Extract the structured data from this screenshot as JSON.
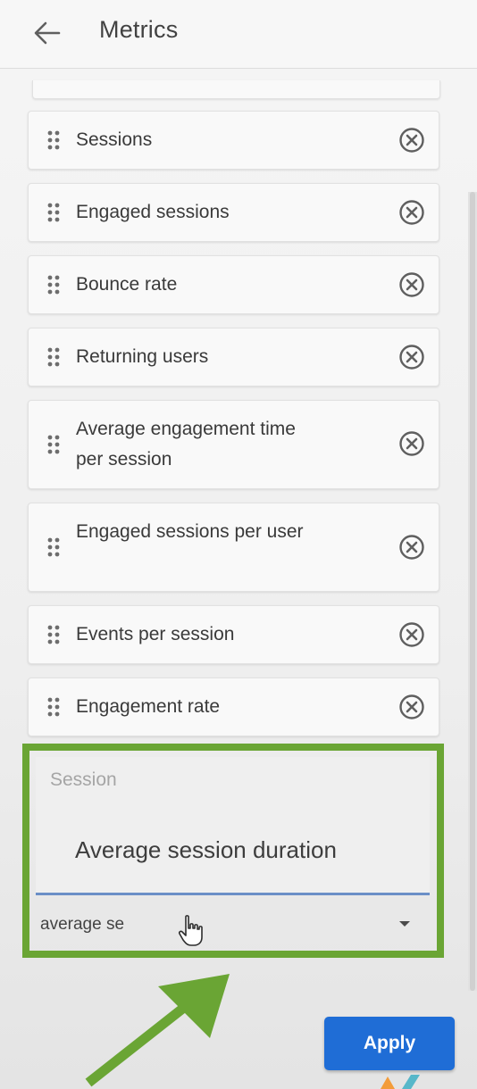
{
  "header": {
    "title": "Metrics",
    "back_icon": "arrow-back-icon"
  },
  "metrics": [
    {
      "label": "Sessions"
    },
    {
      "label": "Engaged sessions"
    },
    {
      "label": "Bounce rate"
    },
    {
      "label": "Returning users"
    },
    {
      "label": "Average engagement time per session"
    },
    {
      "label": "Engaged sessions per user"
    },
    {
      "label": "Events per session"
    },
    {
      "label": "Engagement rate"
    }
  ],
  "metric_icons": {
    "drag": "drag-handle-icon",
    "remove": "remove-circle-icon"
  },
  "suggestions": {
    "group_header": "Session",
    "options": [
      {
        "label": "Average session duration"
      }
    ]
  },
  "search": {
    "value": "average se",
    "dropdown_icon": "caret-down-icon"
  },
  "apply_label": "Apply",
  "colors": {
    "highlight": "#6aa534",
    "apply_button": "#1f6dd6",
    "field_underline": "#6b8fc7",
    "annotation_arrow": "#6aa534"
  }
}
